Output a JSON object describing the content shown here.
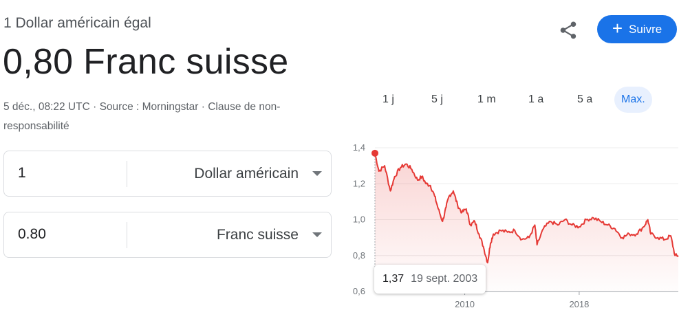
{
  "header": {
    "subtitle": "1 Dollar américain égal",
    "value": "0,80 Franc suisse"
  },
  "meta": {
    "timestamp": "5 déc., 08:22 UTC",
    "separator": " · ",
    "source": "Source : Morningstar",
    "disclaimer": "Clause de non-responsabilité"
  },
  "actions": {
    "share_icon": "share-icon",
    "follow_label": "Suivre"
  },
  "converter": {
    "from": {
      "amount": "1",
      "currency": "Dollar américain"
    },
    "to": {
      "amount": "0.80",
      "currency": "Franc suisse"
    }
  },
  "range_tabs": [
    {
      "label": "1 j",
      "active": false
    },
    {
      "label": "5 j",
      "active": false
    },
    {
      "label": "1 m",
      "active": false
    },
    {
      "label": "1 a",
      "active": false
    },
    {
      "label": "5 a",
      "active": false
    },
    {
      "label": "Max.",
      "active": true
    }
  ],
  "chart_data": {
    "type": "area",
    "y_ticks": [
      "1,4",
      "1,2",
      "1,0",
      "0,8",
      "0,6"
    ],
    "x_ticks": [
      "2010",
      "2018"
    ],
    "ylim": [
      0.6,
      1.4
    ],
    "xlim": [
      2003.72,
      2024.93
    ],
    "grid": true,
    "color": "#e53935",
    "series": [
      {
        "x": [
          2003.72,
          2004.0,
          2004.4,
          2004.8,
          2005.1,
          2005.5,
          2005.9,
          2006.3,
          2006.7,
          2007.0,
          2007.3,
          2007.6,
          2007.9,
          2008.15,
          2008.45,
          2008.7,
          2008.9,
          2009.2,
          2009.5,
          2009.8,
          2010.1,
          2010.4,
          2010.7,
          2011.0,
          2011.3,
          2011.6,
          2011.8,
          2012.0,
          2012.5,
          2013.0,
          2013.5,
          2014.0,
          2014.5,
          2014.9,
          2015.05,
          2015.5,
          2016.0,
          2016.5,
          2017.0,
          2017.5,
          2018.0,
          2018.5,
          2019.0,
          2019.5,
          2020.0,
          2020.5,
          2021.0,
          2021.5,
          2022.0,
          2022.5,
          2022.8,
          2023.0,
          2023.5,
          2024.0,
          2024.4,
          2024.7,
          2024.93
        ],
        "y": [
          1.37,
          1.27,
          1.3,
          1.16,
          1.24,
          1.29,
          1.31,
          1.28,
          1.22,
          1.24,
          1.2,
          1.19,
          1.13,
          1.06,
          0.99,
          1.07,
          1.13,
          1.16,
          1.08,
          1.04,
          1.06,
          0.97,
          0.99,
          0.92,
          0.85,
          0.76,
          0.87,
          0.92,
          0.94,
          0.93,
          0.94,
          0.89,
          0.9,
          0.97,
          0.86,
          0.95,
          0.99,
          0.97,
          1.0,
          0.97,
          0.96,
          1.0,
          1.01,
          0.99,
          0.97,
          0.95,
          0.9,
          0.92,
          0.92,
          0.96,
          1.0,
          0.92,
          0.9,
          0.89,
          0.91,
          0.8,
          0.8
        ]
      }
    ],
    "highlight": {
      "value": "1,37",
      "date": "19 sept. 2003"
    }
  }
}
